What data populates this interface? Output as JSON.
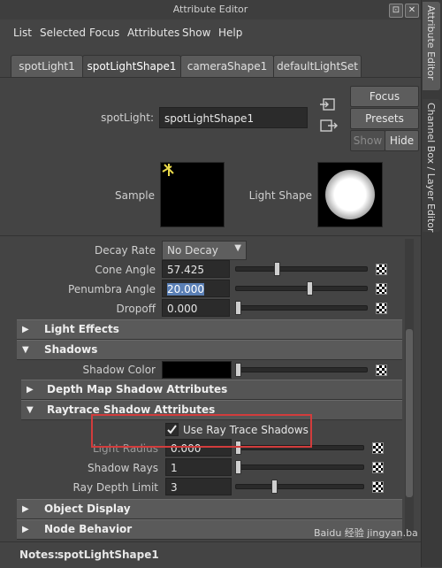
{
  "window": {
    "title": "Attribute Editor",
    "btn_restore": "⊡",
    "btn_close": "✕"
  },
  "menu": [
    "List",
    "Selected",
    "Focus",
    "Attributes",
    "Show",
    "Help"
  ],
  "tabs": [
    "spotLight1",
    "spotLightShape1",
    "cameraShape1",
    "defaultLightSet"
  ],
  "active_tab": 1,
  "side_tabs": [
    "Attribute Editor",
    "Channel Box / Layer Editor"
  ],
  "node": {
    "type_label": "spotLight:",
    "name": "spotLightShape1"
  },
  "buttons": {
    "focus": "Focus",
    "presets": "Presets",
    "show": "Show",
    "hide": "Hide"
  },
  "previews": {
    "sample_label": "Sample",
    "shape_label": "Light Shape"
  },
  "attrs": {
    "decay_rate": {
      "label": "Decay Rate",
      "value": "No Decay"
    },
    "cone_angle": {
      "label": "Cone Angle",
      "value": "57.425",
      "level": 0.31
    },
    "penumbra_angle": {
      "label": "Penumbra Angle",
      "value": "20.000",
      "level": 0.57
    },
    "dropoff": {
      "label": "Dropoff",
      "value": "0.000",
      "level": 0.0
    },
    "shadow_color": {
      "label": "Shadow Color",
      "value": "#000000",
      "level": 0.0
    },
    "use_ray_trace": {
      "label": "Use Ray Trace Shadows",
      "checked": true
    },
    "light_radius": {
      "label": "Light Radius",
      "value": "0.000",
      "level": 0.0
    },
    "shadow_rays": {
      "label": "Shadow Rays",
      "value": "1",
      "level": 0.0
    },
    "ray_depth_limit": {
      "label": "Ray Depth Limit",
      "value": "3",
      "level": 0.3
    }
  },
  "sections": {
    "light_effects": "Light Effects",
    "shadows": "Shadows",
    "depth_map": "Depth Map Shadow Attributes",
    "raytrace": "Raytrace Shadow Attributes",
    "object_display": "Object Display",
    "node_behavior": "Node Behavior"
  },
  "notes": {
    "label": "Notes:",
    "value": "spotLightShape1"
  },
  "watermark": "Baidu 经验  jingyan.baidu.com",
  "colors": {
    "highlight_box": "#d23c3c",
    "selection": "#5a7fb5"
  }
}
